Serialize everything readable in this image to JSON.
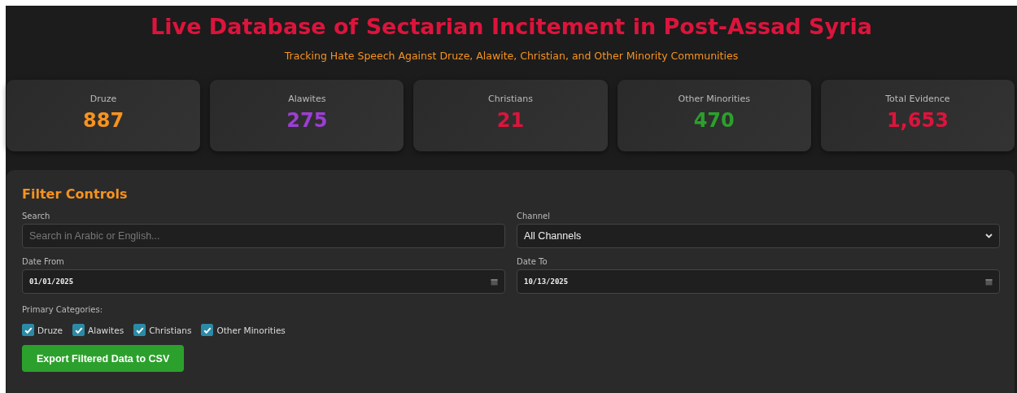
{
  "header": {
    "title": "Live Database of Sectarian Incitement in Post-Assad Syria",
    "subtitle": "Tracking Hate Speech Against Druze, Alawite, Christian, and Other Minority Communities"
  },
  "stats": [
    {
      "label": "Druze",
      "value": "887",
      "color": "#f7931e"
    },
    {
      "label": "Alawites",
      "value": "275",
      "color": "#9b3fd1"
    },
    {
      "label": "Christians",
      "value": "21",
      "color": "#dc143c"
    },
    {
      "label": "Other Minorities",
      "value": "470",
      "color": "#2ca02c"
    },
    {
      "label": "Total Evidence",
      "value": "1,653",
      "color": "#dc143c"
    }
  ],
  "filters": {
    "title": "Filter Controls",
    "fields": [
      {
        "kind": "search",
        "label": "Search",
        "placeholder": "Search in Arabic or English..."
      },
      {
        "kind": "select",
        "label": "Channel",
        "value": "All Channels"
      },
      {
        "kind": "date",
        "label": "Date From",
        "value": "01/01/2025"
      },
      {
        "kind": "date",
        "label": "Date To",
        "value": "10/13/2025"
      }
    ],
    "categories_label": "Primary Categories:",
    "categories": [
      {
        "label": "Druze",
        "checked": true
      },
      {
        "label": "Alawites",
        "checked": true
      },
      {
        "label": "Christians",
        "checked": true
      },
      {
        "label": "Other Minorities",
        "checked": true
      }
    ],
    "export_button": "Export Filtered Data to CSV"
  }
}
